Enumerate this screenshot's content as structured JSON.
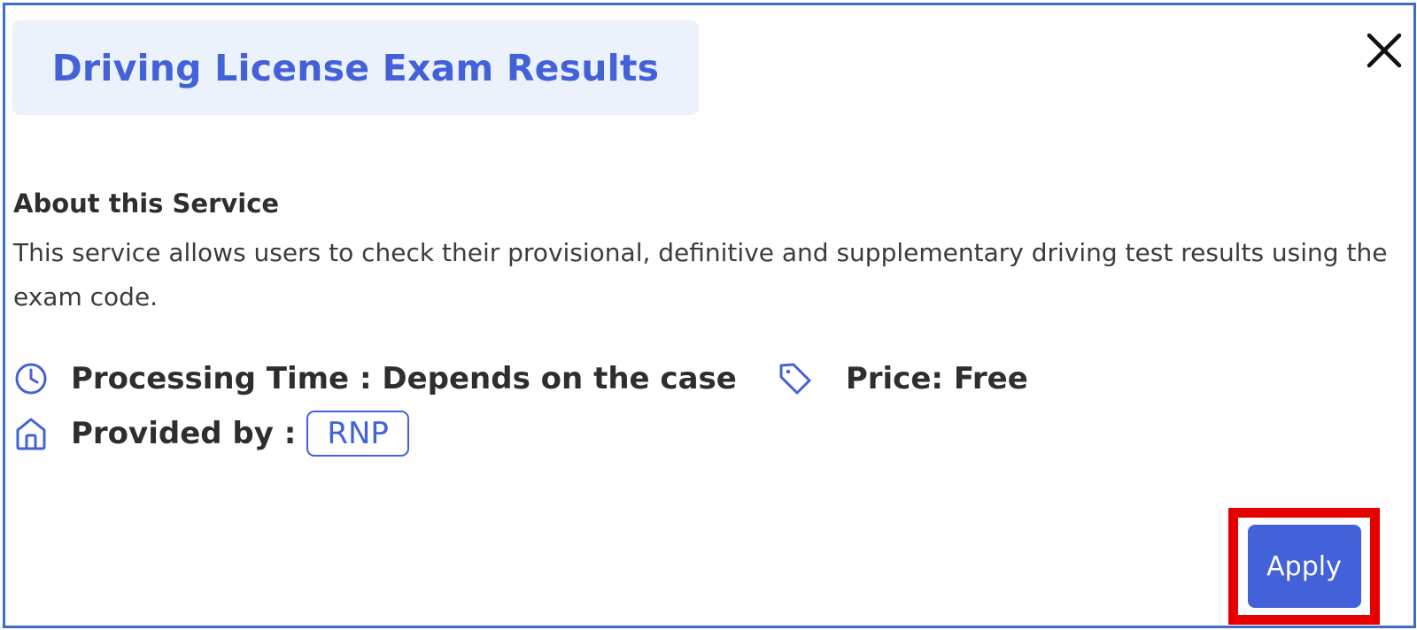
{
  "dialog": {
    "title": "Driving License Exam Results",
    "close_icon": "close-icon"
  },
  "about": {
    "heading": "About this Service",
    "description": "This service allows users to check their provisional, definitive and supplementary driving test results using the exam code."
  },
  "details": {
    "processing_icon": "clock-icon",
    "processing_text": "Processing Time : Depends on the case",
    "price_icon": "tag-icon",
    "price_text": "Price: Free",
    "provider_icon": "home-icon",
    "provider_label": "Provided by :",
    "provider_value": "RNP"
  },
  "actions": {
    "apply_label": "Apply"
  },
  "colors": {
    "accent": "#4361d9",
    "title_background": "#ebf2fb",
    "frame_border": "#3f6cc4",
    "highlight": "#e60000",
    "text_dark": "#2e2e2e"
  }
}
